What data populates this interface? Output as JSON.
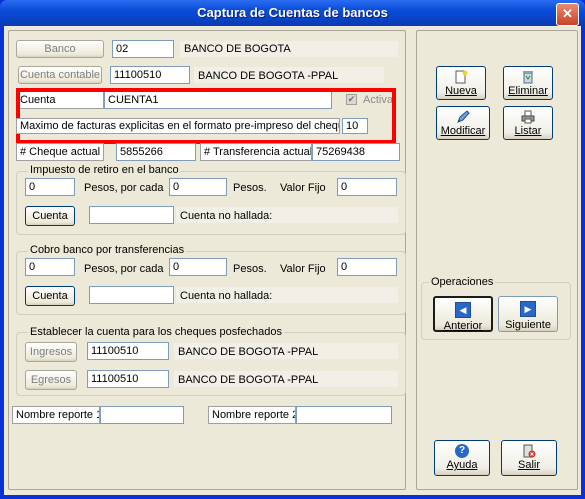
{
  "window": {
    "title": "Captura de Cuentas de bancos",
    "close_glyph": "✕"
  },
  "banco": {
    "button": "Banco",
    "code": "02",
    "name": "BANCO DE BOGOTA"
  },
  "cuenta_contable": {
    "button": "Cuenta contable",
    "code": "11100510",
    "name": "BANCO DE BOGOTA -PPAL"
  },
  "cuenta": {
    "label": "Cuenta",
    "value": "CUENTA1",
    "activa_label": "Activa",
    "activa_checked": true,
    "check_glyph": "✔"
  },
  "max_facturas": {
    "label": "Maximo de facturas explicitas en el formato pre-impreso del cheque",
    "value": "10"
  },
  "cheque_actual": {
    "label": "# Cheque actual",
    "value": "5855266"
  },
  "transferencia_actual": {
    "label": "# Transferencia actual",
    "value": "75269438"
  },
  "impuesto": {
    "title": "Impuesto de retiro en el banco",
    "pesos": "0",
    "pesos_label": "Pesos, por cada",
    "por_cada": "0",
    "por_cada_label": "Pesos.",
    "valor_fijo_label": "Valor Fijo",
    "valor_fijo": "0",
    "cuenta_button": "Cuenta",
    "cuenta_value": "",
    "cuenta_status": "Cuenta no hallada:"
  },
  "cobro": {
    "title": "Cobro banco por  transferencias",
    "pesos": "0",
    "pesos_label": "Pesos, por cada",
    "por_cada": "0",
    "por_cada_label": "Pesos.",
    "valor_fijo_label": "Valor Fijo",
    "valor_fijo": "0",
    "cuenta_button": "Cuenta",
    "cuenta_value": "",
    "cuenta_status": "Cuenta no hallada:"
  },
  "posfechados": {
    "title": "Establecer la cuenta para los cheques posfechados",
    "ingresos_button": "Ingresos",
    "ingresos_code": "11100510",
    "ingresos_name": "BANCO DE BOGOTA -PPAL",
    "egresos_button": "Egresos",
    "egresos_code": "11100510",
    "egresos_name": "BANCO DE BOGOTA -PPAL"
  },
  "reportes": {
    "r1_label": "Nombre reporte 1",
    "r1_value": "",
    "r2_label": "Nombre reporte 2",
    "r2_value": ""
  },
  "actions": {
    "nueva": "Nueva",
    "eliminar": "Eliminar",
    "modificar": "Modificar",
    "listar": "Listar"
  },
  "operaciones": {
    "title": "Operaciones",
    "anterior": "Anterior",
    "siguiente": "Siguiente",
    "anterior_glyph": "◀",
    "siguiente_glyph": "▶"
  },
  "footer": {
    "ayuda": "Ayuda",
    "salir": "Salir",
    "help_glyph": "?"
  },
  "colors": {
    "titlebar": "#0a4bd8",
    "client": "#ece9d8",
    "highlight": "#ff0000"
  }
}
